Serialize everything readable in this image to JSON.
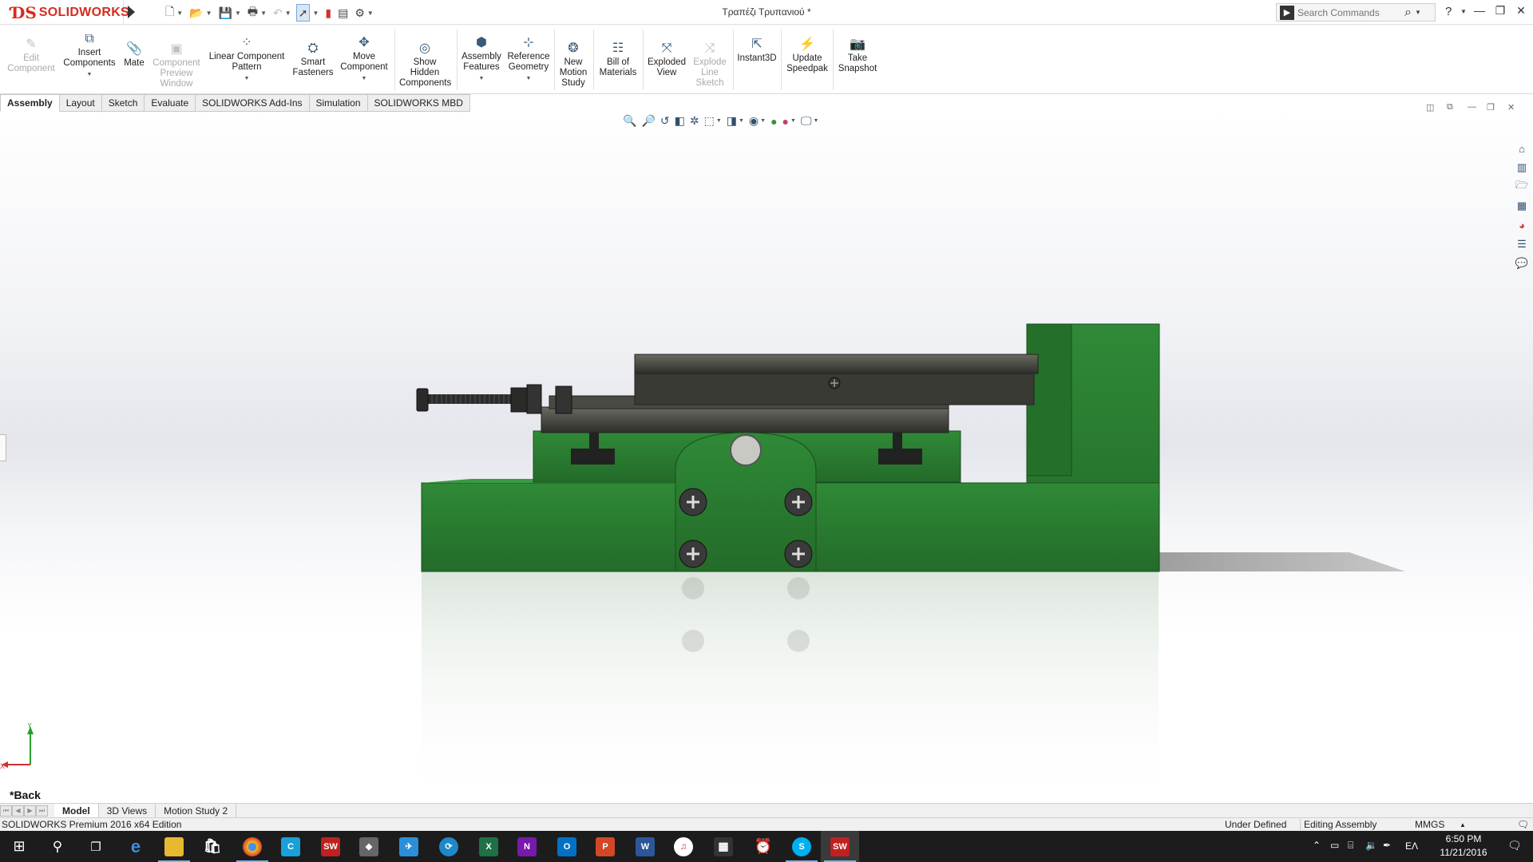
{
  "app": {
    "brand": "SOLIDWORKS",
    "document_title": "Τραπέζι Τρυπανιού *"
  },
  "search": {
    "placeholder": "Search Commands"
  },
  "ribbon": {
    "buttons": [
      {
        "label": "Edit Component",
        "enabled": false
      },
      {
        "label": "Insert Components",
        "enabled": true
      },
      {
        "label": "Mate",
        "enabled": true
      },
      {
        "label": "Component Preview Window",
        "enabled": false
      },
      {
        "label": "Linear Component Pattern",
        "enabled": true
      },
      {
        "label": "Smart Fasteners",
        "enabled": true
      },
      {
        "label": "Move Component",
        "enabled": true
      },
      {
        "label": "Show Hidden Components",
        "enabled": true
      },
      {
        "label": "Assembly Features",
        "enabled": true
      },
      {
        "label": "Reference Geometry",
        "enabled": true
      },
      {
        "label": "New Motion Study",
        "enabled": true
      },
      {
        "label": "Bill of Materials",
        "enabled": true
      },
      {
        "label": "Exploded View",
        "enabled": true
      },
      {
        "label": "Explode Line Sketch",
        "enabled": false
      },
      {
        "label": "Instant3D",
        "enabled": true
      },
      {
        "label": "Update Speedpak",
        "enabled": true
      },
      {
        "label": "Take Snapshot",
        "enabled": true
      }
    ]
  },
  "tabs": [
    "Assembly",
    "Layout",
    "Sketch",
    "Evaluate",
    "SOLIDWORKS Add-Ins",
    "Simulation",
    "SOLIDWORKS MBD"
  ],
  "active_tab": "Assembly",
  "viewport": {
    "view_name": "*Back",
    "triad_x": "X",
    "triad_y": "Y",
    "model_color": "#2e7d32"
  },
  "bottom_tabs": [
    "Model",
    "3D Views",
    "Motion Study 2"
  ],
  "active_bottom_tab": "Model",
  "status": {
    "edition": "SOLIDWORKS Premium 2016 x64 Edition",
    "definition": "Under Defined",
    "mode": "Editing Assembly",
    "units": "MMGS"
  },
  "taskbar": {
    "time": "6:50 PM",
    "date": "11/21/2016",
    "language": "ΕΛ"
  }
}
